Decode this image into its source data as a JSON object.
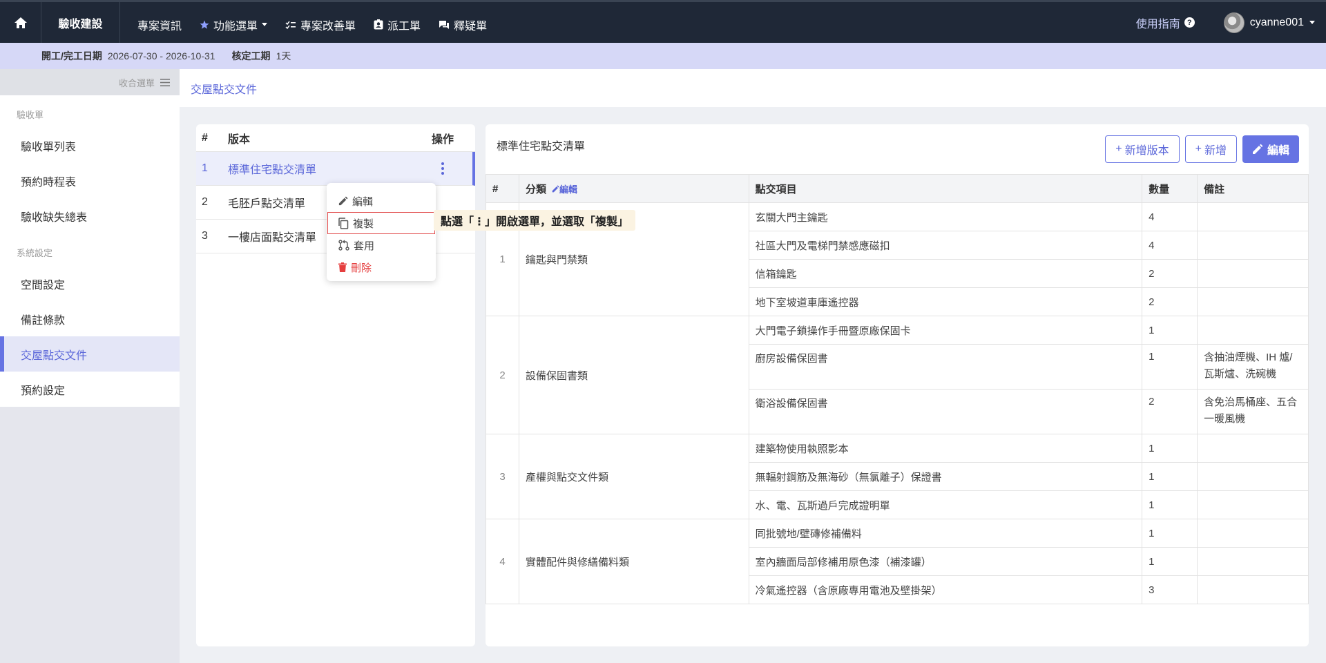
{
  "nav": {
    "brand": "驗收建設",
    "items": [
      {
        "label": "專案資訊",
        "icon": "none"
      },
      {
        "label": "功能選單",
        "icon": "star-icon"
      },
      {
        "label": "專案改善單",
        "icon": "checklist-icon"
      },
      {
        "label": "派工單",
        "icon": "badge-icon"
      },
      {
        "label": "釋疑單",
        "icon": "chat-icon"
      }
    ],
    "guide": "使用指南",
    "username": "cyanne001"
  },
  "info": {
    "date_label": "開工/完工日期",
    "date_value": "2026-07-30 - 2026-10-31",
    "period_label": "核定工期",
    "period_value": "1天"
  },
  "sidebar": {
    "collapse_label": "收合選單",
    "section1": "驗收單",
    "items1": [
      "驗收單列表",
      "預約時程表",
      "驗收缺失總表"
    ],
    "section2": "系統設定",
    "items2": [
      "空間設定",
      "備註條款",
      "交屋點交文件",
      "預約設定"
    ],
    "active": "交屋點交文件"
  },
  "breadcrumb": "交屋點交文件",
  "versions": {
    "headers": {
      "num": "#",
      "version": "版本",
      "op": "操作"
    },
    "rows": [
      {
        "num": "1",
        "name": "標準住宅點交清單"
      },
      {
        "num": "2",
        "name": "毛胚戶點交清單"
      },
      {
        "num": "3",
        "name": "一樓店面點交清單"
      }
    ]
  },
  "menu": {
    "edit": "編輯",
    "copy": "複製",
    "apply": "套用",
    "delete": "刪除"
  },
  "tooltip": "點選「⋮」開啟選單，並選取「複製」",
  "detail": {
    "title": "標準住宅點交清單",
    "btn_new_version": "新增版本",
    "btn_add": "新增",
    "btn_edit": "編輯",
    "headers": {
      "num": "#",
      "category": "分類",
      "category_edit": "編輯",
      "item": "點交項目",
      "qty": "數量",
      "note": "備註"
    },
    "groups": [
      {
        "num": "1",
        "category": "鑰匙與門禁類",
        "items": [
          {
            "name": "玄關大門主鑰匙",
            "qty": "4",
            "note": ""
          },
          {
            "name": "社區大門及電梯門禁感應磁扣",
            "qty": "4",
            "note": ""
          },
          {
            "name": "信箱鑰匙",
            "qty": "2",
            "note": ""
          },
          {
            "name": "地下室坡道車庫遙控器",
            "qty": "2",
            "note": ""
          }
        ]
      },
      {
        "num": "2",
        "category": "設備保固書類",
        "items": [
          {
            "name": "大門電子鎖操作手冊暨原廠保固卡",
            "qty": "1",
            "note": ""
          },
          {
            "name": "廚房設備保固書",
            "qty": "1",
            "note": "含抽油煙機、IH 爐/瓦斯爐、洗碗機"
          },
          {
            "name": "衛浴設備保固書",
            "qty": "2",
            "note": "含免治馬桶座、五合一暖風機"
          }
        ]
      },
      {
        "num": "3",
        "category": "產權與點交文件類",
        "items": [
          {
            "name": "建築物使用執照影本",
            "qty": "1",
            "note": ""
          },
          {
            "name": "無輻射鋼筋及無海砂（無氯離子）保證書",
            "qty": "1",
            "note": ""
          },
          {
            "name": "水、電、瓦斯過戶完成證明單",
            "qty": "1",
            "note": ""
          }
        ]
      },
      {
        "num": "4",
        "category": "實體配件與修繕備料類",
        "items": [
          {
            "name": "同批號地/壁磚修補備料",
            "qty": "1",
            "note": ""
          },
          {
            "name": "室內牆面局部修補用原色漆（補漆罐）",
            "qty": "1",
            "note": ""
          },
          {
            "name": "冷氣遙控器（含原廠專用電池及壁掛架）",
            "qty": "3",
            "note": ""
          }
        ]
      }
    ]
  },
  "colors": {
    "accent": "#6673e3",
    "nav_bg": "#1f2837",
    "info_bg": "#d6d8f7",
    "danger": "#e53e3e"
  }
}
